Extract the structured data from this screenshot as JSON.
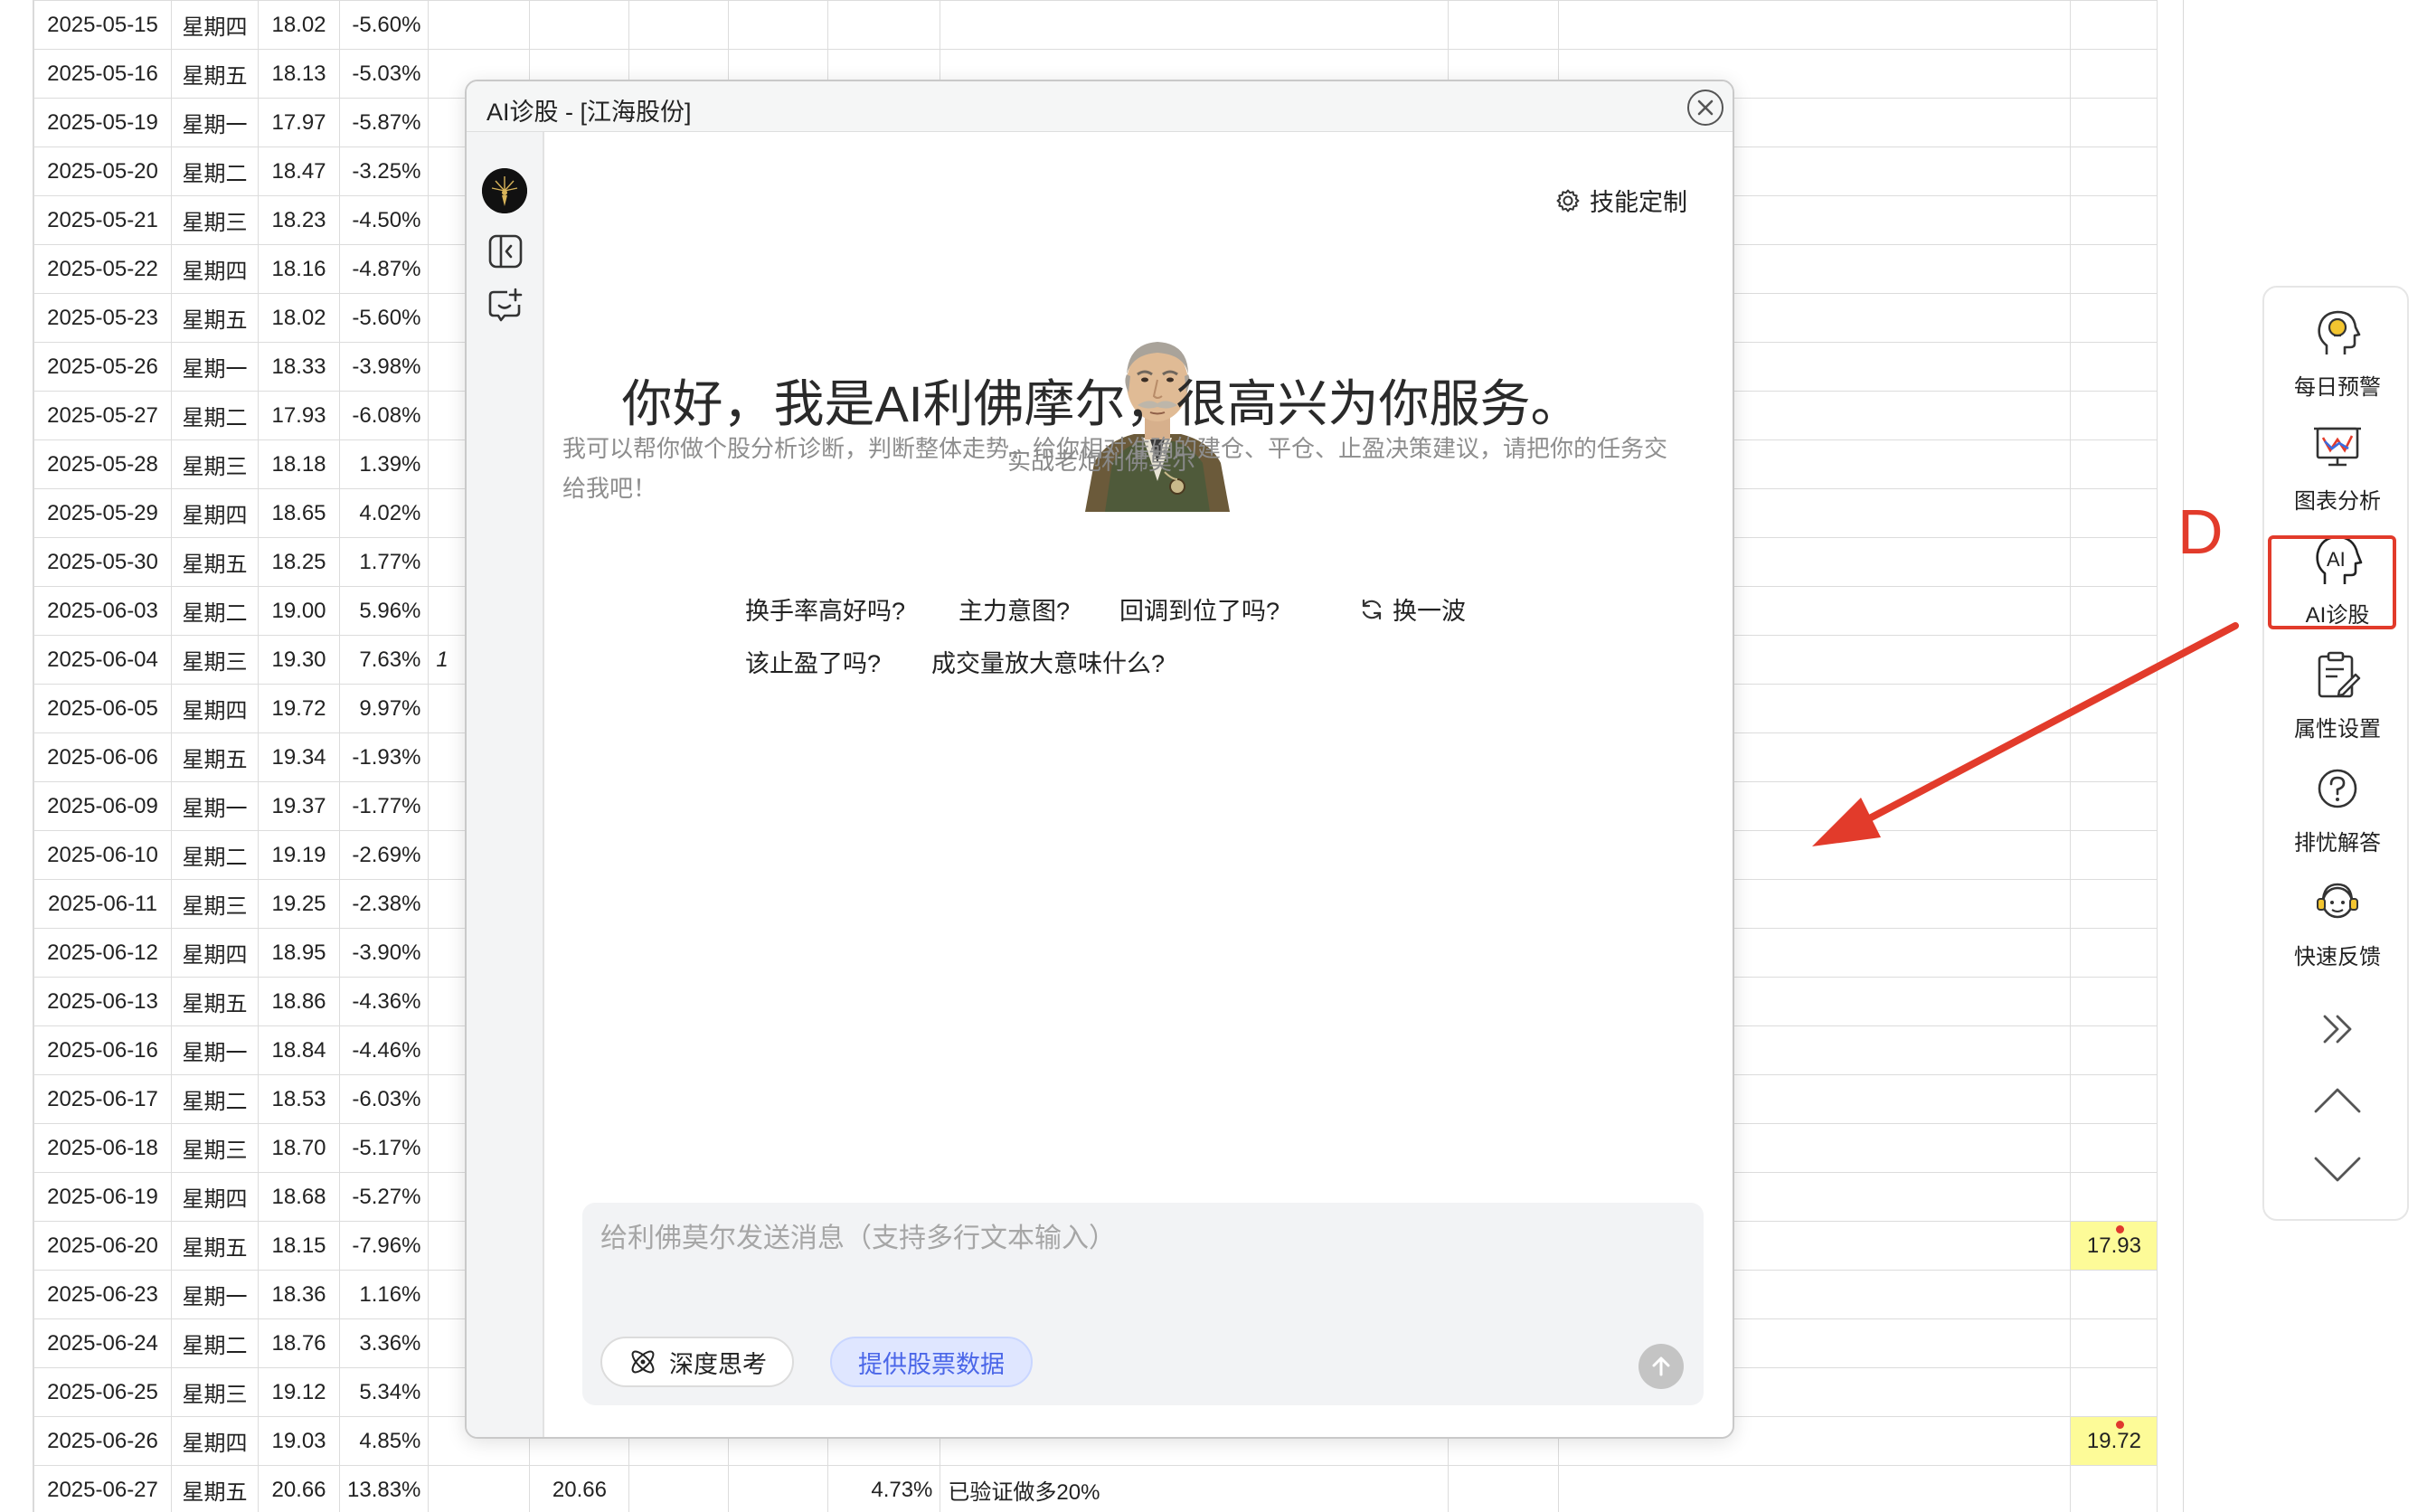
{
  "sheet": {
    "rows": [
      {
        "date": "2025-05-15",
        "weekday": "星期四",
        "price": "18.02",
        "pct": "-5.60%"
      },
      {
        "date": "2025-05-16",
        "weekday": "星期五",
        "price": "18.13",
        "pct": "-5.03%"
      },
      {
        "date": "2025-05-19",
        "weekday": "星期一",
        "price": "17.97",
        "pct": "-5.87%"
      },
      {
        "date": "2025-05-20",
        "weekday": "星期二",
        "price": "18.47",
        "pct": "-3.25%"
      },
      {
        "date": "2025-05-21",
        "weekday": "星期三",
        "price": "18.23",
        "pct": "-4.50%"
      },
      {
        "date": "2025-05-22",
        "weekday": "星期四",
        "price": "18.16",
        "pct": "-4.87%"
      },
      {
        "date": "2025-05-23",
        "weekday": "星期五",
        "price": "18.02",
        "pct": "-5.60%"
      },
      {
        "date": "2025-05-26",
        "weekday": "星期一",
        "price": "18.33",
        "pct": "-3.98%"
      },
      {
        "date": "2025-05-27",
        "weekday": "星期二",
        "price": "17.93",
        "pct": "-6.08%"
      },
      {
        "date": "2025-05-28",
        "weekday": "星期三",
        "price": "18.18",
        "pct": "1.39%"
      },
      {
        "date": "2025-05-29",
        "weekday": "星期四",
        "price": "18.65",
        "pct": "4.02%"
      },
      {
        "date": "2025-05-30",
        "weekday": "星期五",
        "price": "18.25",
        "pct": "1.77%"
      },
      {
        "date": "2025-06-03",
        "weekday": "星期二",
        "price": "19.00",
        "pct": "5.96%"
      },
      {
        "date": "2025-06-04",
        "weekday": "星期三",
        "price": "19.30",
        "pct": "7.63%",
        "e": "1"
      },
      {
        "date": "2025-06-05",
        "weekday": "星期四",
        "price": "19.72",
        "pct": "9.97%"
      },
      {
        "date": "2025-06-06",
        "weekday": "星期五",
        "price": "19.34",
        "pct": "-1.93%"
      },
      {
        "date": "2025-06-09",
        "weekday": "星期一",
        "price": "19.37",
        "pct": "-1.77%"
      },
      {
        "date": "2025-06-10",
        "weekday": "星期二",
        "price": "19.19",
        "pct": "-2.69%"
      },
      {
        "date": "2025-06-11",
        "weekday": "星期三",
        "price": "19.25",
        "pct": "-2.38%"
      },
      {
        "date": "2025-06-12",
        "weekday": "星期四",
        "price": "18.95",
        "pct": "-3.90%"
      },
      {
        "date": "2025-06-13",
        "weekday": "星期五",
        "price": "18.86",
        "pct": "-4.36%"
      },
      {
        "date": "2025-06-16",
        "weekday": "星期一",
        "price": "18.84",
        "pct": "-4.46%"
      },
      {
        "date": "2025-06-17",
        "weekday": "星期二",
        "price": "18.53",
        "pct": "-6.03%"
      },
      {
        "date": "2025-06-18",
        "weekday": "星期三",
        "price": "18.70",
        "pct": "-5.17%"
      },
      {
        "date": "2025-06-19",
        "weekday": "星期四",
        "price": "18.68",
        "pct": "-5.27%"
      },
      {
        "date": "2025-06-20",
        "weekday": "星期五",
        "price": "18.15",
        "pct": "-7.96%",
        "m": "17.93"
      },
      {
        "date": "2025-06-23",
        "weekday": "星期一",
        "price": "18.36",
        "pct": "1.16%"
      },
      {
        "date": "2025-06-24",
        "weekday": "星期二",
        "price": "18.76",
        "pct": "3.36%"
      },
      {
        "date": "2025-06-25",
        "weekday": "星期三",
        "price": "19.12",
        "pct": "5.34%"
      },
      {
        "date": "2025-06-26",
        "weekday": "星期四",
        "price": "19.03",
        "pct": "4.85%",
        "m": "19.72"
      },
      {
        "date": "2025-06-27",
        "weekday": "星期五",
        "price": "20.66",
        "pct": "13.83%",
        "f": "20.66",
        "i": "4.73%",
        "j": "已验证做多20%"
      }
    ]
  },
  "dialog": {
    "title": "AI诊股 - [江海股份]",
    "skill_label": "技能定制",
    "persona_name": "实战老炮利佛莫尔",
    "greeting": "你好，我是AI利佛摩尔，很高兴为你服务。",
    "intro": "我可以帮你做个股分析诊断，判断整体走势，给你相对准确的建仓、平仓、止盈决策建议，请把你的任务交给我吧！",
    "questions": [
      "换手率高好吗?",
      "主力意图?",
      "回调到位了吗?",
      "该止盈了吗?",
      "成交量放大意味什么?"
    ],
    "refresh_label": "换一波",
    "input_placeholder": "给利佛莫尔发送消息（支持多行文本输入）",
    "deep_think_label": "深度思考",
    "provide_data_label": "提供股票数据"
  },
  "toolbar": {
    "items": [
      {
        "label": "每日预警",
        "icon": "head-idea-icon"
      },
      {
        "label": "图表分析",
        "icon": "chart-analysis-icon"
      },
      {
        "label": "AI诊股",
        "icon": "ai-head-icon"
      },
      {
        "label": "属性设置",
        "icon": "clipboard-edit-icon"
      },
      {
        "label": "排忧解答",
        "icon": "question-circle-icon"
      },
      {
        "label": "快速反馈",
        "icon": "support-agent-icon"
      }
    ]
  },
  "annotation": {
    "letter": "D",
    "color": "#e23b2b"
  },
  "colors": {
    "highlight_cell": "#fdfb98",
    "accent_blue": "#4a66e8",
    "annotation_red": "#e23b2b"
  }
}
